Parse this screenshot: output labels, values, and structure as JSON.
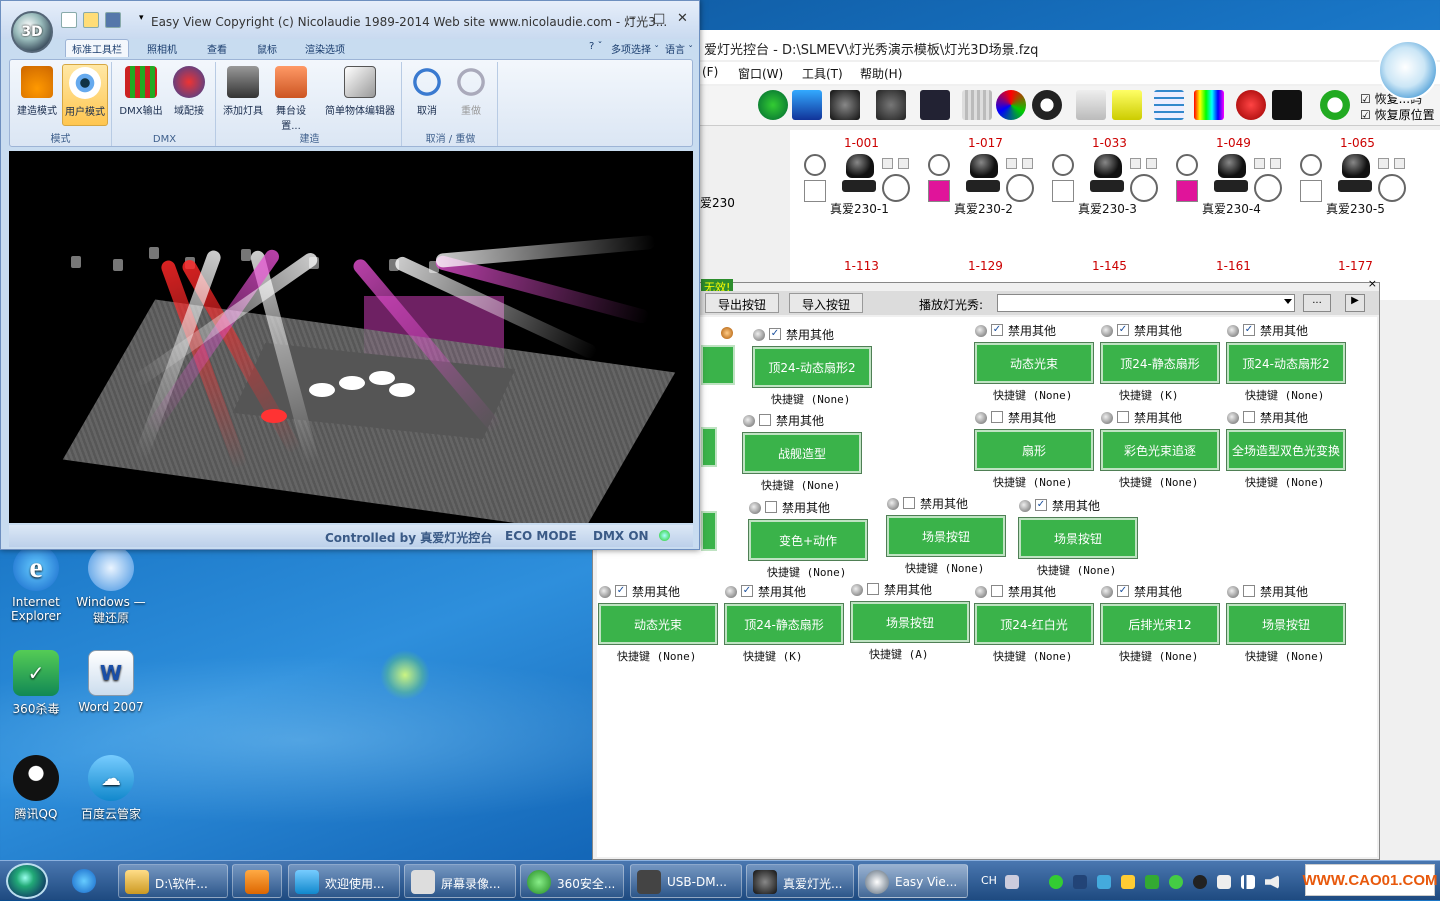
{
  "desktop": {
    "icons": [
      {
        "label1": "Internet",
        "label2": "Explorer"
      },
      {
        "label1": "Windows —",
        "label2": "键还原"
      },
      {
        "label1": "360杀毒",
        "label2": ""
      },
      {
        "label1": "Word 2007",
        "label2": ""
      },
      {
        "label1": "腾讯QQ",
        "label2": ""
      },
      {
        "label1": "百度云管家",
        "label2": ""
      }
    ]
  },
  "easyview": {
    "orb": "3D",
    "title": "Easy View   Copyright (c) Nicolaudie 1989-2014   Web site www.nicolaudie.com - 灯光3...",
    "tabs": [
      "标准工具栏",
      "照相机",
      "查看",
      "鼠标",
      "渲染选项"
    ],
    "tab_right": [
      "? ˇ",
      "多项选择 ˇ",
      "语言 ˇ"
    ],
    "groups": [
      {
        "name": "模式",
        "buttons": [
          "建造模式",
          "用户模式"
        ]
      },
      {
        "name": "DMX",
        "buttons": [
          "DMX输出",
          "域配接"
        ]
      },
      {
        "name": "建造",
        "buttons": [
          "添加灯具",
          "舞台设置...",
          "简单物体编辑器"
        ]
      },
      {
        "name": "取消 / 重做",
        "buttons": [
          "取消",
          "重做"
        ]
      }
    ],
    "status": [
      "Controlled by 真爱灯光控台",
      "ECO MODE",
      "DMX ON"
    ]
  },
  "mainapp": {
    "title": "爱灯光控台 - D:\\SLMEV\\灯光秀演示模板\\灯光3D场景.fzq",
    "menu": [
      "(F)",
      "窗口(W)",
      "工具(T)",
      "帮助(H)"
    ],
    "restore": [
      "恢复...码",
      "恢复原位置"
    ],
    "fixture_partial": "爱230",
    "fixtures_row1": [
      {
        "addr": "1-001",
        "name": "真爱230-1",
        "color": "#ffffff"
      },
      {
        "addr": "1-017",
        "name": "真爱230-2",
        "color": "#e0149a"
      },
      {
        "addr": "1-033",
        "name": "真爱230-3",
        "color": "#ffffff"
      },
      {
        "addr": "1-049",
        "name": "真爱230-4",
        "color": "#e0149a"
      },
      {
        "addr": "1-065",
        "name": "真爱230-5",
        "color": "#ffffff"
      }
    ],
    "fixtures_row2": [
      "1-113",
      "1-129",
      "1-145",
      "1-161",
      "1-177"
    ]
  },
  "buttonpanel": {
    "invalid_label": "无效!",
    "export_label": "导出按钮",
    "import_label": "导入按钮",
    "play_label": "播放灯光秀:",
    "browse_label": "...",
    "play_btn": "▶",
    "disable_label": "禁用其他",
    "cells": [
      {
        "name": "顶24-动态扇形2",
        "hotkey": "快捷键 (None)",
        "checked": "✓"
      },
      {
        "name": "动态光束",
        "hotkey": "快捷键 (None)",
        "checked": "✓"
      },
      {
        "name": "顶24-静态扇形",
        "hotkey": "快捷键 (K)",
        "checked": "✓"
      },
      {
        "name": "顶24-动态扇形2",
        "hotkey": "快捷键 (None)",
        "checked": "✓"
      },
      {
        "name": "战舰造型",
        "hotkey": "快捷键 (None)",
        "checked": ""
      },
      {
        "name": "扇形",
        "hotkey": "快捷键 (None)",
        "checked": ""
      },
      {
        "name": "彩色光束追逐",
        "hotkey": "快捷键 (None)",
        "checked": ""
      },
      {
        "name": "全场造型双色光变换",
        "hotkey": "快捷键 (None)",
        "checked": ""
      },
      {
        "name": "变色+动作",
        "hotkey": "快捷键 (None)",
        "checked": ""
      },
      {
        "name": "场景按钮",
        "hotkey": "快捷键 (None)",
        "checked": ""
      },
      {
        "name": "场景按钮",
        "hotkey": "快捷键 (None)",
        "checked": "✓"
      },
      {
        "name": "动态光束",
        "hotkey": "快捷键 (None)",
        "checked": "✓"
      },
      {
        "name": "顶24-静态扇形",
        "hotkey": "快捷键 (K)",
        "checked": "✓"
      },
      {
        "name": "场景按钮",
        "hotkey": "快捷键 (A)",
        "checked": ""
      },
      {
        "name": "顶24-红白光",
        "hotkey": "快捷键 (None)",
        "checked": ""
      },
      {
        "name": "后排光束12",
        "hotkey": "快捷键 (None)",
        "checked": "✓"
      },
      {
        "name": "场景按钮",
        "hotkey": "快捷键 (None)",
        "checked": ""
      }
    ]
  },
  "taskbar": {
    "items": [
      "D:\\软件...",
      "",
      "欢迎使用...",
      "屏幕录像...",
      "360安全...",
      "USB-DM...",
      "真爱灯光...",
      "Easy Vie..."
    ],
    "tray_lang": "CH"
  },
  "watermark": "WWW.CAO01.COM"
}
